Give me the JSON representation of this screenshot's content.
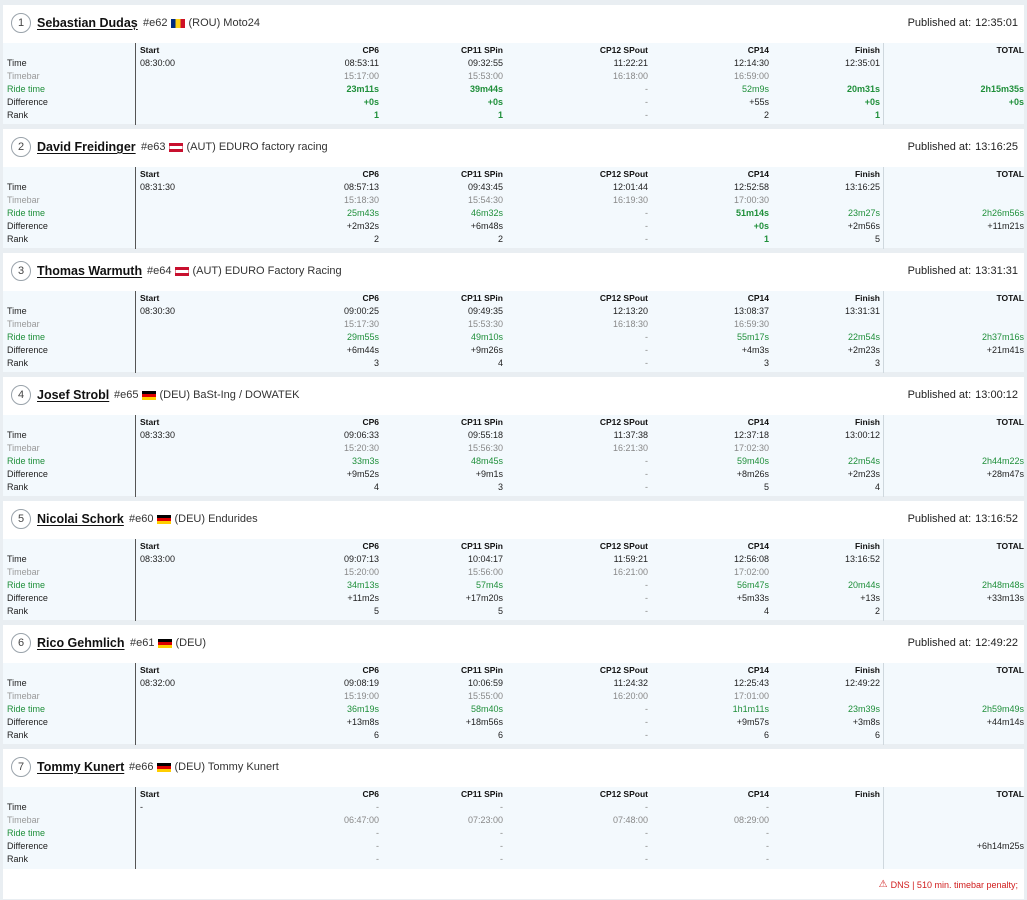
{
  "labels": {
    "published_prefix": "Published at:",
    "start": "Start",
    "row_time": "Time",
    "row_timebar": "Timebar",
    "row_ride": "Ride time",
    "row_diff": "Difference",
    "row_rank": "Rank"
  },
  "columns": [
    "CP6",
    "CP11 SPin",
    "CP12 SPout",
    "CP14",
    "Finish",
    "TOTAL"
  ],
  "colors": {
    "ride_green": "#1f8f3a",
    "penalty_red": "#d01c1c"
  },
  "riders": [
    {
      "pos": "1",
      "name": "Sebastian Dudaș",
      "number": "#e62",
      "flag": "ROU",
      "info": "(ROU) Moto24",
      "published": "12:35:01",
      "start": "08:30:00",
      "time": [
        "08:53:11",
        "09:32:55",
        "11:22:21",
        "12:14:30",
        "12:35:01",
        ""
      ],
      "timebar": [
        "15:17:00",
        "15:53:00",
        "16:18:00",
        "16:59:00",
        "",
        ""
      ],
      "ride": [
        "23m11s",
        "39m44s",
        "-",
        "52m9s",
        "20m31s",
        "2h15m35s"
      ],
      "ride_bold": [
        true,
        true,
        false,
        false,
        true,
        true
      ],
      "diff": [
        "+0s",
        "+0s",
        "-",
        "+55s",
        "+0s",
        "+0s"
      ],
      "diff_green": [
        true,
        true,
        false,
        false,
        true,
        true
      ],
      "rank": [
        "1",
        "1",
        "-",
        "2",
        "1",
        ""
      ],
      "rank_green": [
        true,
        true,
        false,
        false,
        true,
        false
      ],
      "penalty": ""
    },
    {
      "pos": "2",
      "name": "David Freidinger",
      "number": "#e63",
      "flag": "AUT",
      "info": "(AUT) EDURO factory racing",
      "published": "13:16:25",
      "start": "08:31:30",
      "time": [
        "08:57:13",
        "09:43:45",
        "12:01:44",
        "12:52:58",
        "13:16:25",
        ""
      ],
      "timebar": [
        "15:18:30",
        "15:54:30",
        "16:19:30",
        "17:00:30",
        "",
        ""
      ],
      "ride": [
        "25m43s",
        "46m32s",
        "-",
        "51m14s",
        "23m27s",
        "2h26m56s"
      ],
      "ride_bold": [
        false,
        false,
        false,
        true,
        false,
        false
      ],
      "diff": [
        "+2m32s",
        "+6m48s",
        "-",
        "+0s",
        "+2m56s",
        "+11m21s"
      ],
      "diff_green": [
        false,
        false,
        false,
        true,
        false,
        false
      ],
      "rank": [
        "2",
        "2",
        "-",
        "1",
        "5",
        ""
      ],
      "rank_green": [
        false,
        false,
        false,
        true,
        false,
        false
      ],
      "penalty": ""
    },
    {
      "pos": "3",
      "name": "Thomas Warmuth",
      "number": "#e64",
      "flag": "AUT",
      "info": "(AUT) EDURO Factory Racing",
      "published": "13:31:31",
      "start": "08:30:30",
      "time": [
        "09:00:25",
        "09:49:35",
        "12:13:20",
        "13:08:37",
        "13:31:31",
        ""
      ],
      "timebar": [
        "15:17:30",
        "15:53:30",
        "16:18:30",
        "16:59:30",
        "",
        ""
      ],
      "ride": [
        "29m55s",
        "49m10s",
        "-",
        "55m17s",
        "22m54s",
        "2h37m16s"
      ],
      "ride_bold": [
        false,
        false,
        false,
        false,
        false,
        false
      ],
      "diff": [
        "+6m44s",
        "+9m26s",
        "-",
        "+4m3s",
        "+2m23s",
        "+21m41s"
      ],
      "diff_green": [
        false,
        false,
        false,
        false,
        false,
        false
      ],
      "rank": [
        "3",
        "4",
        "-",
        "3",
        "3",
        ""
      ],
      "rank_green": [
        false,
        false,
        false,
        false,
        false,
        false
      ],
      "penalty": ""
    },
    {
      "pos": "4",
      "name": "Josef Strobl",
      "number": "#e65",
      "flag": "DEU",
      "info": "(DEU) BaSt-Ing / DOWATEK",
      "published": "13:00:12",
      "start": "08:33:30",
      "time": [
        "09:06:33",
        "09:55:18",
        "11:37:38",
        "12:37:18",
        "13:00:12",
        ""
      ],
      "timebar": [
        "15:20:30",
        "15:56:30",
        "16:21:30",
        "17:02:30",
        "",
        ""
      ],
      "ride": [
        "33m3s",
        "48m45s",
        "-",
        "59m40s",
        "22m54s",
        "2h44m22s"
      ],
      "ride_bold": [
        false,
        false,
        false,
        false,
        false,
        false
      ],
      "diff": [
        "+9m52s",
        "+9m1s",
        "-",
        "+8m26s",
        "+2m23s",
        "+28m47s"
      ],
      "diff_green": [
        false,
        false,
        false,
        false,
        false,
        false
      ],
      "rank": [
        "4",
        "3",
        "-",
        "5",
        "4",
        ""
      ],
      "rank_green": [
        false,
        false,
        false,
        false,
        false,
        false
      ],
      "penalty": ""
    },
    {
      "pos": "5",
      "name": "Nicolai Schork",
      "number": "#e60",
      "flag": "DEU",
      "info": "(DEU) Endurides",
      "published": "13:16:52",
      "start": "08:33:00",
      "time": [
        "09:07:13",
        "10:04:17",
        "11:59:21",
        "12:56:08",
        "13:16:52",
        ""
      ],
      "timebar": [
        "15:20:00",
        "15:56:00",
        "16:21:00",
        "17:02:00",
        "",
        ""
      ],
      "ride": [
        "34m13s",
        "57m4s",
        "-",
        "56m47s",
        "20m44s",
        "2h48m48s"
      ],
      "ride_bold": [
        false,
        false,
        false,
        false,
        false,
        false
      ],
      "diff": [
        "+11m2s",
        "+17m20s",
        "-",
        "+5m33s",
        "+13s",
        "+33m13s"
      ],
      "diff_green": [
        false,
        false,
        false,
        false,
        false,
        false
      ],
      "rank": [
        "5",
        "5",
        "-",
        "4",
        "2",
        ""
      ],
      "rank_green": [
        false,
        false,
        false,
        false,
        false,
        false
      ],
      "penalty": ""
    },
    {
      "pos": "6",
      "name": "Rico Gehmlich",
      "number": "#e61",
      "flag": "DEU",
      "info": "(DEU)",
      "published": "12:49:22",
      "start": "08:32:00",
      "time": [
        "09:08:19",
        "10:06:59",
        "11:24:32",
        "12:25:43",
        "12:49:22",
        ""
      ],
      "timebar": [
        "15:19:00",
        "15:55:00",
        "16:20:00",
        "17:01:00",
        "",
        ""
      ],
      "ride": [
        "36m19s",
        "58m40s",
        "-",
        "1h1m11s",
        "23m39s",
        "2h59m49s"
      ],
      "ride_bold": [
        false,
        false,
        false,
        false,
        false,
        false
      ],
      "diff": [
        "+13m8s",
        "+18m56s",
        "-",
        "+9m57s",
        "+3m8s",
        "+44m14s"
      ],
      "diff_green": [
        false,
        false,
        false,
        false,
        false,
        false
      ],
      "rank": [
        "6",
        "6",
        "-",
        "6",
        "6",
        ""
      ],
      "rank_green": [
        false,
        false,
        false,
        false,
        false,
        false
      ],
      "penalty": ""
    },
    {
      "pos": "7",
      "name": "Tommy Kunert",
      "number": "#e66",
      "flag": "DEU",
      "info": "(DEU) Tommy Kunert",
      "published": "",
      "start": "-",
      "time": [
        "-",
        "-",
        "-",
        "-",
        "",
        ""
      ],
      "timebar": [
        "06:47:00",
        "07:23:00",
        "07:48:00",
        "08:29:00",
        "",
        ""
      ],
      "ride": [
        "-",
        "-",
        "-",
        "-",
        "",
        ""
      ],
      "ride_bold": [
        false,
        false,
        false,
        false,
        false,
        false
      ],
      "diff": [
        "-",
        "-",
        "-",
        "-",
        "",
        "+6h14m25s"
      ],
      "diff_green": [
        false,
        false,
        false,
        false,
        false,
        false
      ],
      "rank": [
        "-",
        "-",
        "-",
        "-",
        "",
        ""
      ],
      "rank_green": [
        false,
        false,
        false,
        false,
        false,
        false
      ],
      "penalty": "DNS | 510 min. timebar penalty;"
    }
  ]
}
